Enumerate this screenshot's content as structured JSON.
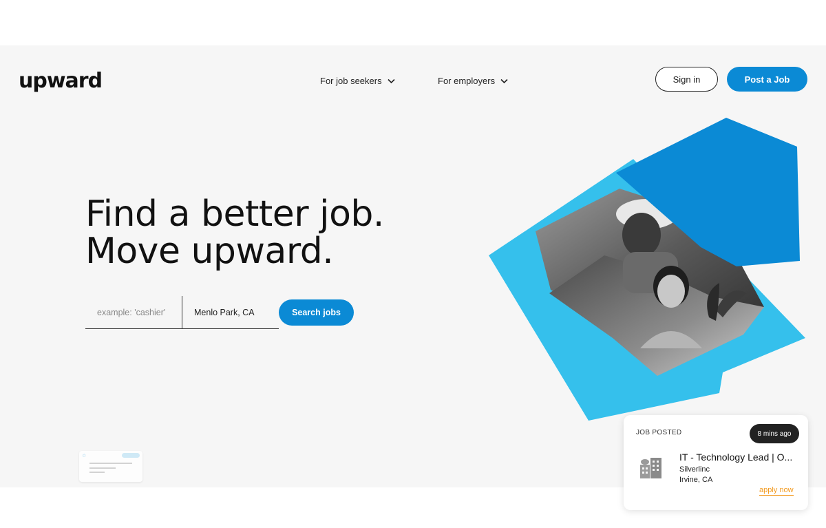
{
  "brand": {
    "logo_text": "upward"
  },
  "nav": {
    "items": [
      {
        "label": "For job seekers",
        "icon": "chevron-down-icon"
      },
      {
        "label": "For employers",
        "icon": "chevron-down-icon"
      }
    ],
    "sign_in_label": "Sign in",
    "post_job_label": "Post a Job"
  },
  "hero": {
    "headline_line1": "Find a better job.",
    "headline_line2": "Move upward."
  },
  "search": {
    "what_placeholder": "example: 'cashier'",
    "where_value": "Menlo Park, CA",
    "button_label": "Search jobs"
  },
  "job_card": {
    "label": "JOB POSTED",
    "time": "8 mins ago",
    "title": "IT - Technology Lead | O...",
    "company": "Silverlinc",
    "location": "Irvine, CA",
    "apply_label": "apply now",
    "icon": "building-icon"
  },
  "colors": {
    "brand_blue": "#0b8ad5",
    "light_blue": "#35c0ec",
    "apply_orange": "#f39a1e"
  }
}
